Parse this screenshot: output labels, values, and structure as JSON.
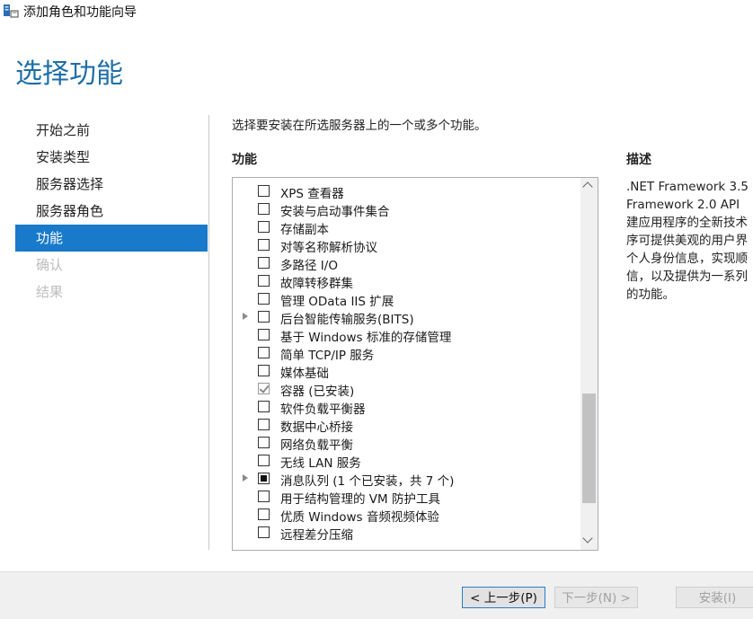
{
  "window": {
    "title": "添加角色和功能向导",
    "icon": "server-manager-icon"
  },
  "page_title": "选择功能",
  "nav": {
    "items": [
      {
        "label": "开始之前",
        "state": "normal"
      },
      {
        "label": "安装类型",
        "state": "normal"
      },
      {
        "label": "服务器选择",
        "state": "normal"
      },
      {
        "label": "服务器角色",
        "state": "normal"
      },
      {
        "label": "功能",
        "state": "active"
      },
      {
        "label": "确认",
        "state": "disabled"
      },
      {
        "label": "结果",
        "state": "disabled"
      }
    ]
  },
  "instruction": "选择要安装在所选服务器上的一个或多个功能。",
  "features": {
    "heading": "功能",
    "items": [
      {
        "label": "XPS 查看器",
        "checked": false,
        "expandable": false
      },
      {
        "label": "安装与启动事件集合",
        "checked": false,
        "expandable": false
      },
      {
        "label": "存储副本",
        "checked": false,
        "expandable": false
      },
      {
        "label": "对等名称解析协议",
        "checked": false,
        "expandable": false
      },
      {
        "label": "多路径 I/O",
        "checked": false,
        "expandable": false
      },
      {
        "label": "故障转移群集",
        "checked": false,
        "expandable": false
      },
      {
        "label": "管理 OData IIS 扩展",
        "checked": false,
        "expandable": false
      },
      {
        "label": "后台智能传输服务(BITS)",
        "checked": false,
        "expandable": true
      },
      {
        "label": "基于 Windows 标准的存储管理",
        "checked": false,
        "expandable": false
      },
      {
        "label": "简单 TCP/IP 服务",
        "checked": false,
        "expandable": false
      },
      {
        "label": "媒体基础",
        "checked": false,
        "expandable": false
      },
      {
        "label": "容器 (已安装)",
        "checked": "installed",
        "expandable": false
      },
      {
        "label": "软件负载平衡器",
        "checked": false,
        "expandable": false
      },
      {
        "label": "数据中心桥接",
        "checked": false,
        "expandable": false
      },
      {
        "label": "网络负载平衡",
        "checked": false,
        "expandable": false
      },
      {
        "label": "无线 LAN 服务",
        "checked": false,
        "expandable": false
      },
      {
        "label": "消息队列 (1 个已安装，共 7 个)",
        "checked": "partial",
        "expandable": true
      },
      {
        "label": "用于结构管理的 VM 防护工具",
        "checked": false,
        "expandable": false
      },
      {
        "label": "优质 Windows 音频视频体验",
        "checked": false,
        "expandable": false
      },
      {
        "label": "远程差分压缩",
        "checked": false,
        "expandable": false
      }
    ],
    "scroll_position": 0.58
  },
  "description": {
    "heading": "描述",
    "lines": [
      ".NET Framework 3.5",
      "Framework 2.0 API",
      "建应用程序的全新技术",
      "序可提供美观的用户界",
      "个人身份信息，实现顺",
      "信，以及提供为一系列",
      "的功能。"
    ]
  },
  "buttons": {
    "previous": "< 上一步(P)",
    "next": "下一步(N) >",
    "install": "安装(I)"
  }
}
